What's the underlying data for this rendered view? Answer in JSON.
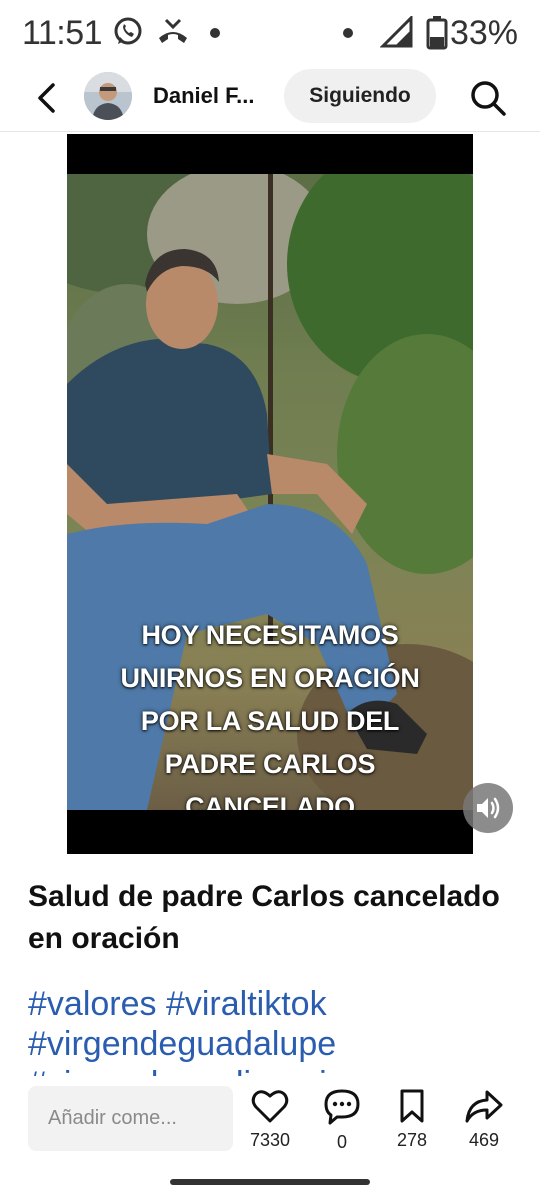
{
  "status_bar": {
    "time": "11:51",
    "battery": "33%",
    "icons": [
      "whatsapp-icon",
      "missed-call-icon",
      "dot-icon",
      "dot-icon",
      "signal-icon",
      "battery-icon"
    ]
  },
  "header": {
    "back_icon": "chevron-left-icon",
    "author_name": "Daniel F...",
    "follow_label": "Siguiendo",
    "search_icon": "search-icon"
  },
  "video": {
    "overlay_lines": [
      "HOY NECESITAMOS",
      "UNIRNOS EN ORACIÓN",
      "POR LA SALUD DEL",
      "PADRE CARLOS",
      "CANCELADO"
    ],
    "mute_icon": "volume-icon"
  },
  "post": {
    "title": "Salud de padre Carlos cancelado en oración",
    "hashtags": [
      "#valores #viraltiktok",
      "#virgendeguadalupe",
      "#virgendemedjugorje"
    ]
  },
  "bottom_bar": {
    "comment_placeholder": "Añadir come...",
    "likes": "7330",
    "comments": "0",
    "saves": "278",
    "shares": "469"
  },
  "colors": {
    "hashtag": "#2a5db0",
    "follow_bg": "#f0f0f0",
    "input_bg": "#f2f2f2"
  }
}
